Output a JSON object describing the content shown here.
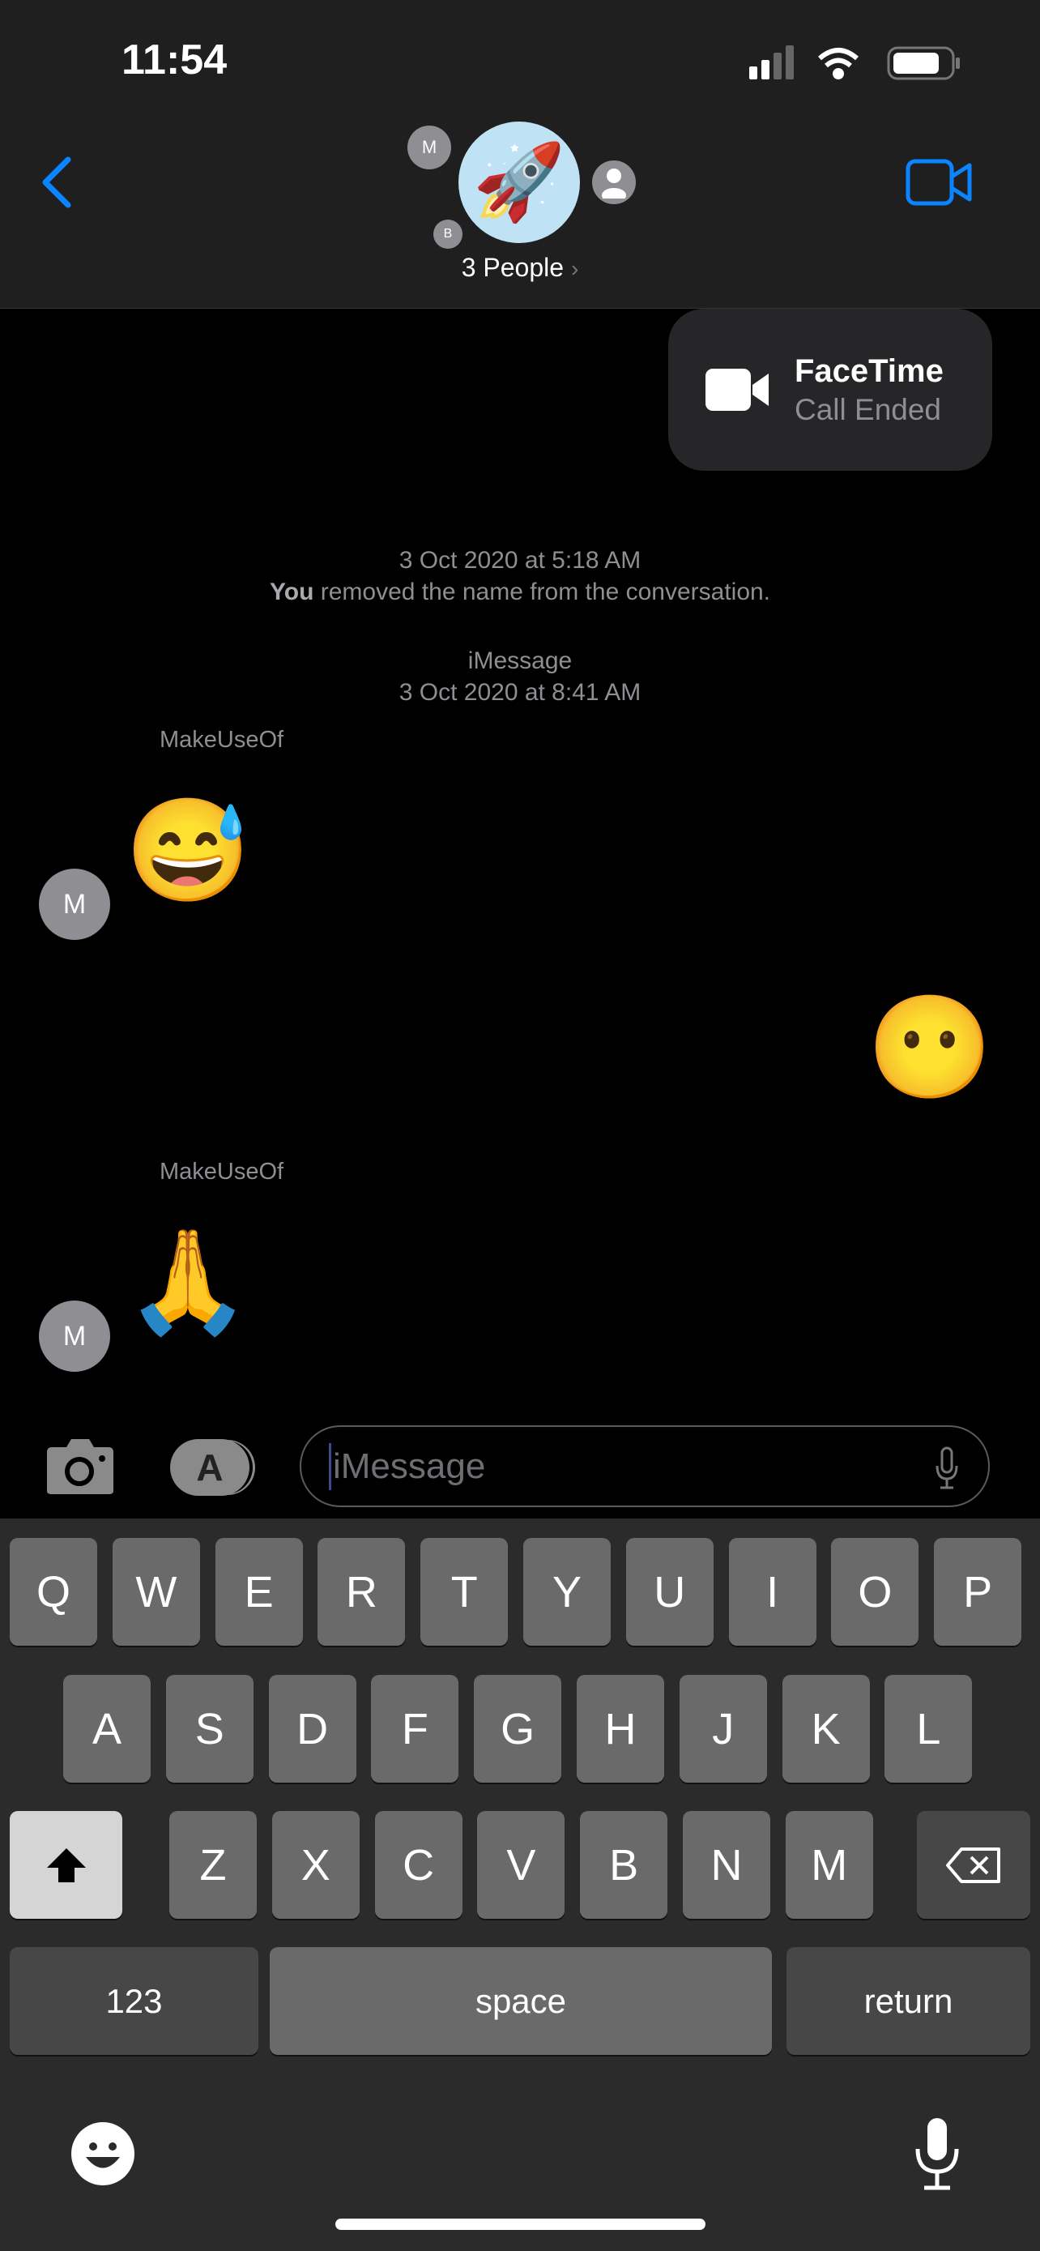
{
  "status": {
    "time": "11:54"
  },
  "header": {
    "group_label": "3 People",
    "avatar_emoji": "🚀",
    "member_initials": [
      "M",
      "B"
    ]
  },
  "facetime": {
    "title": "FaceTime",
    "subtitle": "Call Ended"
  },
  "system": [
    {
      "date": "3 Oct 2020 at 5:18 AM",
      "actor": "You",
      "text": " removed the name from the conversation."
    },
    {
      "service": "iMessage",
      "date": "3 Oct 2020 at 8:41 AM"
    }
  ],
  "messages": [
    {
      "sender": "MakeUseOf",
      "initial": "M",
      "emoji": "😅"
    },
    {
      "sender": "",
      "emoji": "😶"
    },
    {
      "sender": "MakeUseOf",
      "initial": "M",
      "emoji": "🙏"
    }
  ],
  "input": {
    "placeholder": "iMessage"
  },
  "keyboard": {
    "row1": [
      "Q",
      "W",
      "E",
      "R",
      "T",
      "Y",
      "U",
      "I",
      "O",
      "P"
    ],
    "row2": [
      "A",
      "S",
      "D",
      "F",
      "G",
      "H",
      "J",
      "K",
      "L"
    ],
    "row3": [
      "Z",
      "X",
      "C",
      "V",
      "B",
      "N",
      "M"
    ],
    "numbers": "123",
    "space": "space",
    "return": "return"
  },
  "colors": {
    "accent": "#0a84ff",
    "bubble": "#262628"
  }
}
